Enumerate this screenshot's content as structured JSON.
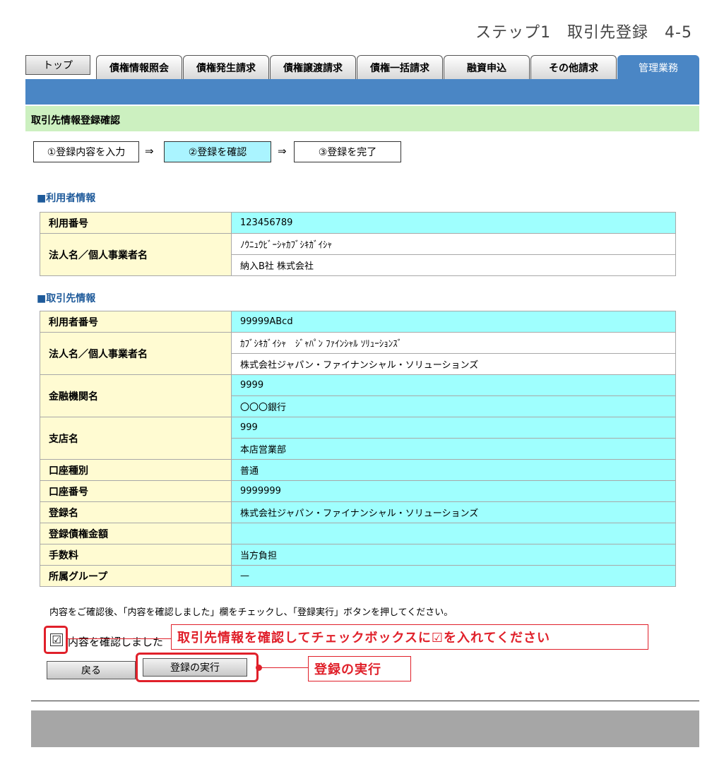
{
  "step_title": "ステップ1　取引先登録　4-5",
  "tabs": [
    {
      "label": "トップ"
    },
    {
      "label": "債権情報照会"
    },
    {
      "label": "債権発生請求"
    },
    {
      "label": "債権譲渡請求"
    },
    {
      "label": "債権一括請求"
    },
    {
      "label": "融資申込"
    },
    {
      "label": "その他請求"
    },
    {
      "label": "管理業務"
    }
  ],
  "page_heading": "取引先情報登録確認",
  "steps": {
    "step1": "①登録内容を入力",
    "step2": "②登録を確認",
    "step3": "③登録を完了",
    "arrow": "⇒"
  },
  "user_info": {
    "title": "■利用者情報",
    "rows": [
      {
        "label": "利用番号",
        "value": "123456789"
      },
      {
        "label": "法人名／個人事業者名",
        "kana": "ﾉｳﾆｭｳﾋﾞｰｼｬｶﾌﾞｼｷｶﾞｲｼｬ",
        "value": "納入B社 株式会社"
      }
    ]
  },
  "partner_info": {
    "title": "■取引先情報",
    "user_number": {
      "label": "利用者番号",
      "value": "99999ABcd"
    },
    "corp_name": {
      "label": "法人名／個人事業者名",
      "kana": "ｶﾌﾞｼｷｶﾞｲｼｬ　ｼﾞｬﾊﾟﾝ ﾌｧｲﾝｼｬﾙ ｿﾘｭｰｼｮﾝｽﾞ",
      "value": "株式会社ジャパン・ファイナンシャル・ソリューションズ"
    },
    "bank": {
      "label": "金融機関名",
      "code": "9999",
      "value": "〇〇〇銀行"
    },
    "branch": {
      "label": "支店名",
      "code": "999",
      "value": "本店営業部"
    },
    "account_type": {
      "label": "口座種別",
      "value": "普通"
    },
    "account_number": {
      "label": "口座番号",
      "value": "9999999"
    },
    "registered_name": {
      "label": "登録名",
      "value": "株式会社ジャパン・ファイナンシャル・ソリューションズ"
    },
    "amount": {
      "label": "登録債権金額",
      "value": ""
    },
    "fee": {
      "label": "手数料",
      "value": "当方負担"
    },
    "group": {
      "label": "所属グループ",
      "value": "—"
    }
  },
  "instruction": "内容をご確認後、「内容を確認しました」欄をチェックし、「登録実行」ボタンを押してください。",
  "confirm": {
    "checkmark": "☑",
    "label": "内容を確認しました"
  },
  "callouts": {
    "check": "取引先情報を確認してチェックボックスに☑を入れてください",
    "execute": "登録の実行"
  },
  "buttons": {
    "back": "戻る",
    "execute": "登録の実行"
  },
  "colors": {
    "accent_blue": "#4a86c5",
    "highlight_red": "#e0202a",
    "label_bg": "#fffbd2",
    "value_bg": "#9ffffe",
    "heading_bg": "#ccf0c0"
  }
}
